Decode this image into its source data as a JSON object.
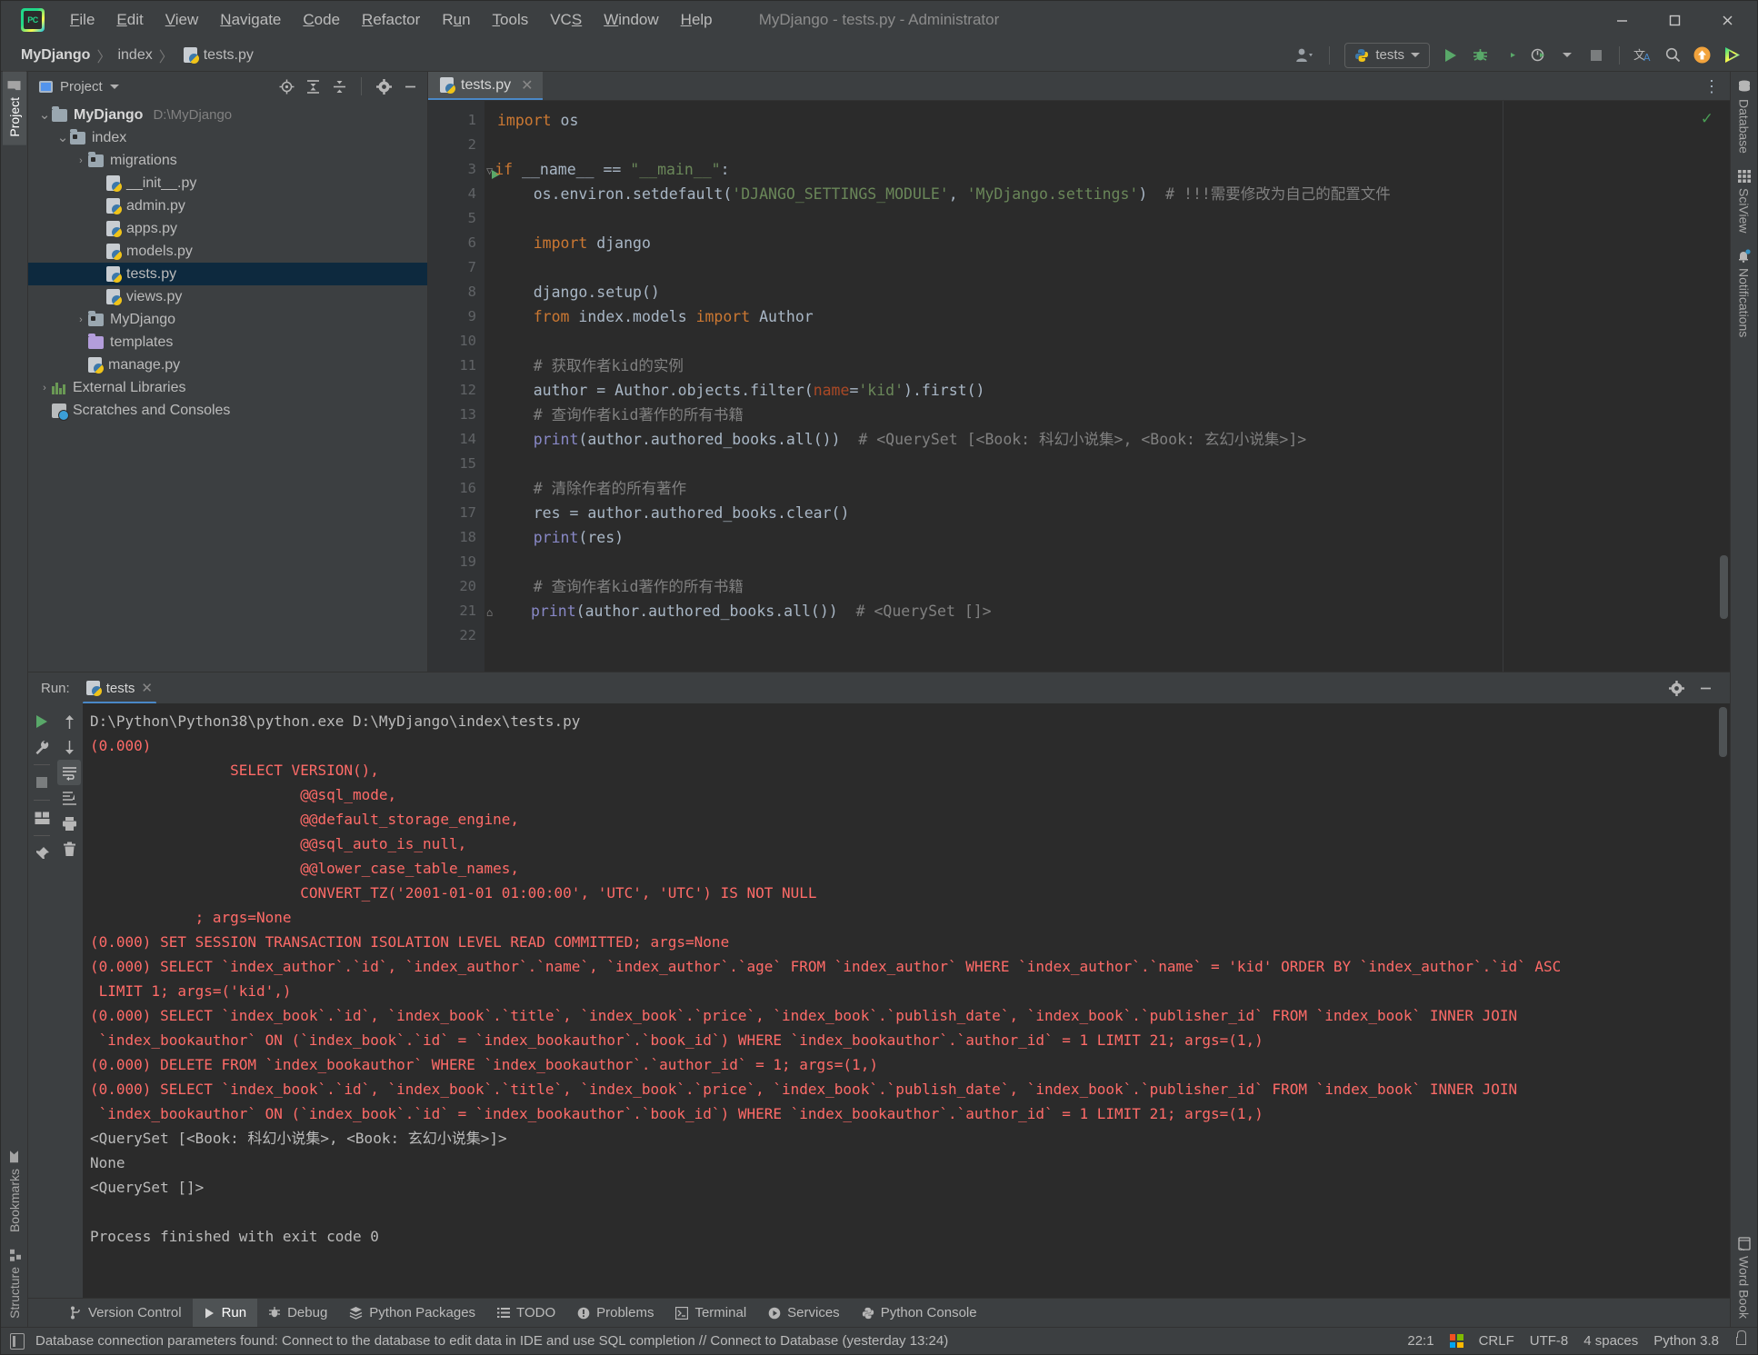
{
  "window": {
    "title": "MyDjango - tests.py - Administrator",
    "minimize": "–",
    "maximize": "☐",
    "close": "✕"
  },
  "menubar": [
    {
      "label": "File",
      "mnemonic": "F"
    },
    {
      "label": "Edit",
      "mnemonic": "E"
    },
    {
      "label": "View",
      "mnemonic": "V"
    },
    {
      "label": "Navigate",
      "mnemonic": "N"
    },
    {
      "label": "Code",
      "mnemonic": "C"
    },
    {
      "label": "Refactor",
      "mnemonic": "R"
    },
    {
      "label": "Run",
      "mnemonic": "u"
    },
    {
      "label": "Tools",
      "mnemonic": "T"
    },
    {
      "label": "VCS",
      "mnemonic": "S"
    },
    {
      "label": "Window",
      "mnemonic": "W"
    },
    {
      "label": "Help",
      "mnemonic": "H"
    }
  ],
  "breadcrumb": {
    "items": [
      "MyDjango",
      "index",
      "tests.py"
    ],
    "separator": "〉"
  },
  "toolbar": {
    "run_config": "tests",
    "icons": [
      "profile-icon",
      "python-icon",
      "run-icon",
      "debug-icon",
      "coverage-icon",
      "profiler-icon",
      "stop-icon",
      "translate-icon",
      "search-everywhere-icon",
      "update-icon",
      "play-gradient-icon"
    ]
  },
  "project_panel": {
    "title": "Project",
    "header_icons": [
      "locate-icon",
      "expand-all-icon",
      "collapse-all-icon",
      "settings-gear-icon",
      "hide-icon"
    ],
    "tree": [
      {
        "label": "MyDjango",
        "path": "D:\\MyDjango",
        "kind": "folder",
        "depth": 0,
        "arrow": "⌄",
        "bold": true
      },
      {
        "label": "index",
        "kind": "folder-src",
        "depth": 1,
        "arrow": "⌄"
      },
      {
        "label": "migrations",
        "kind": "folder-src",
        "depth": 2,
        "arrow": "›"
      },
      {
        "label": "__init__.py",
        "kind": "py",
        "depth": 3
      },
      {
        "label": "admin.py",
        "kind": "py",
        "depth": 3
      },
      {
        "label": "apps.py",
        "kind": "py",
        "depth": 3
      },
      {
        "label": "models.py",
        "kind": "py",
        "depth": 3
      },
      {
        "label": "tests.py",
        "kind": "py",
        "depth": 3,
        "selected": true
      },
      {
        "label": "views.py",
        "kind": "py",
        "depth": 3
      },
      {
        "label": "MyDjango",
        "kind": "folder-src",
        "depth": 2,
        "arrow": "›"
      },
      {
        "label": "templates",
        "kind": "folder-purple",
        "depth": 2
      },
      {
        "label": "manage.py",
        "kind": "py",
        "depth": 2
      },
      {
        "label": "External Libraries",
        "kind": "libs",
        "depth": 0,
        "arrow": "›"
      },
      {
        "label": "Scratches and Consoles",
        "kind": "scratch",
        "depth": 0
      }
    ]
  },
  "editor": {
    "tab": {
      "label": "tests.py",
      "close": "✕"
    },
    "overflow": "⋮",
    "lines": [
      {
        "n": 1,
        "tokens": [
          {
            "t": "import ",
            "c": "k"
          },
          {
            "t": "os",
            "c": "t"
          }
        ]
      },
      {
        "n": 2,
        "tokens": []
      },
      {
        "n": 3,
        "tokens": [
          {
            "t": "if ",
            "c": "k"
          },
          {
            "t": "__name__ ",
            "c": "t"
          },
          {
            "t": "== ",
            "c": "t"
          },
          {
            "t": "\"__main__\"",
            "c": "s"
          },
          {
            "t": ":",
            "c": "t"
          }
        ],
        "runmark": true,
        "fold": "▽"
      },
      {
        "n": 4,
        "tokens": [
          {
            "t": "    os.environ.setdefault(",
            "c": "t"
          },
          {
            "t": "'DJANGO_SETTINGS_MODULE'",
            "c": "s"
          },
          {
            "t": ", ",
            "c": "t"
          },
          {
            "t": "'MyDjango.settings'",
            "c": "s"
          },
          {
            "t": ")  ",
            "c": "t"
          },
          {
            "t": "# !!!需要修改为自己的配置文件",
            "c": "c"
          }
        ]
      },
      {
        "n": 5,
        "tokens": []
      },
      {
        "n": 6,
        "tokens": [
          {
            "t": "    ",
            "c": "t"
          },
          {
            "t": "import ",
            "c": "k"
          },
          {
            "t": "django",
            "c": "t"
          }
        ]
      },
      {
        "n": 7,
        "tokens": []
      },
      {
        "n": 8,
        "tokens": [
          {
            "t": "    django.setup()",
            "c": "t"
          }
        ]
      },
      {
        "n": 9,
        "tokens": [
          {
            "t": "    ",
            "c": "t"
          },
          {
            "t": "from ",
            "c": "k"
          },
          {
            "t": "index.models ",
            "c": "t"
          },
          {
            "t": "import ",
            "c": "k"
          },
          {
            "t": "Author",
            "c": "t"
          }
        ]
      },
      {
        "n": 10,
        "tokens": []
      },
      {
        "n": 11,
        "tokens": [
          {
            "t": "    # 获取作者kid的实例",
            "c": "c"
          }
        ]
      },
      {
        "n": 12,
        "tokens": [
          {
            "t": "    author = Author.objects.filter(",
            "c": "t"
          },
          {
            "t": "name",
            "c": "na"
          },
          {
            "t": "=",
            "c": "t"
          },
          {
            "t": "'kid'",
            "c": "s"
          },
          {
            "t": ").first()",
            "c": "t"
          }
        ]
      },
      {
        "n": 13,
        "tokens": [
          {
            "t": "    # 查询作者kid著作的所有书籍",
            "c": "c"
          }
        ]
      },
      {
        "n": 14,
        "tokens": [
          {
            "t": "    ",
            "c": "t"
          },
          {
            "t": "print",
            "c": "pf"
          },
          {
            "t": "(author.authored_books.all())  ",
            "c": "t"
          },
          {
            "t": "# <QuerySet [<Book: 科幻小说集>, <Book: 玄幻小说集>]>",
            "c": "c"
          }
        ]
      },
      {
        "n": 15,
        "tokens": []
      },
      {
        "n": 16,
        "tokens": [
          {
            "t": "    # 清除作者的所有著作",
            "c": "c"
          }
        ]
      },
      {
        "n": 17,
        "tokens": [
          {
            "t": "    res = author.authored_books.clear()",
            "c": "t"
          }
        ]
      },
      {
        "n": 18,
        "tokens": [
          {
            "t": "    ",
            "c": "t"
          },
          {
            "t": "print",
            "c": "pf"
          },
          {
            "t": "(res)",
            "c": "t"
          }
        ]
      },
      {
        "n": 19,
        "tokens": []
      },
      {
        "n": 20,
        "tokens": [
          {
            "t": "    # 查询作者kid著作的所有书籍",
            "c": "c"
          }
        ]
      },
      {
        "n": 21,
        "tokens": [
          {
            "t": "    ",
            "c": "t"
          },
          {
            "t": "print",
            "c": "pf"
          },
          {
            "t": "(author.authored_books.all())  ",
            "c": "t"
          },
          {
            "t": "# <QuerySet []>",
            "c": "c"
          }
        ],
        "foldend": "⌂"
      },
      {
        "n": 22,
        "tokens": []
      }
    ]
  },
  "run_panel": {
    "label": "Run:",
    "tab": "tests",
    "tab_close": "✕",
    "sidebar_icons": [
      "rerun-icon",
      "wrench-icon",
      "stop-icon",
      "layout-icon",
      "pin-icon"
    ],
    "sidebar2_icons": [
      "up-arrow-icon",
      "down-arrow-icon",
      "soft-wrap-icon",
      "scroll-to-end-icon",
      "print-icon",
      "trash-icon"
    ],
    "header_icons": [
      "settings-gear-icon",
      "hide-icon"
    ],
    "console": [
      {
        "text": "D:\\Python\\Python38\\python.exe D:\\MyDjango\\index\\tests.py",
        "style": "path"
      },
      {
        "text": "(0.000)",
        "style": "err"
      },
      {
        "text": "                SELECT VERSION(),",
        "style": "err"
      },
      {
        "text": "                        @@sql_mode,",
        "style": "err"
      },
      {
        "text": "                        @@default_storage_engine,",
        "style": "err"
      },
      {
        "text": "                        @@sql_auto_is_null,",
        "style": "err"
      },
      {
        "text": "                        @@lower_case_table_names,",
        "style": "err"
      },
      {
        "text": "                        CONVERT_TZ('2001-01-01 01:00:00', 'UTC', 'UTC') IS NOT NULL",
        "style": "err"
      },
      {
        "text": "            ; args=None",
        "style": "err"
      },
      {
        "text": "(0.000) SET SESSION TRANSACTION ISOLATION LEVEL READ COMMITTED; args=None",
        "style": "err"
      },
      {
        "text": "(0.000) SELECT `index_author`.`id`, `index_author`.`name`, `index_author`.`age` FROM `index_author` WHERE `index_author`.`name` = 'kid' ORDER BY `index_author`.`id` ASC",
        "style": "err"
      },
      {
        "text": " LIMIT 1; args=('kid',)",
        "style": "err"
      },
      {
        "text": "(0.000) SELECT `index_book`.`id`, `index_book`.`title`, `index_book`.`price`, `index_book`.`publish_date`, `index_book`.`publisher_id` FROM `index_book` INNER JOIN",
        "style": "err"
      },
      {
        "text": " `index_bookauthor` ON (`index_book`.`id` = `index_bookauthor`.`book_id`) WHERE `index_bookauthor`.`author_id` = 1 LIMIT 21; args=(1,)",
        "style": "err"
      },
      {
        "text": "(0.000) DELETE FROM `index_bookauthor` WHERE `index_bookauthor`.`author_id` = 1; args=(1,)",
        "style": "err"
      },
      {
        "text": "(0.000) SELECT `index_book`.`id`, `index_book`.`title`, `index_book`.`price`, `index_book`.`publish_date`, `index_book`.`publisher_id` FROM `index_book` INNER JOIN",
        "style": "err"
      },
      {
        "text": " `index_bookauthor` ON (`index_book`.`id` = `index_bookauthor`.`book_id`) WHERE `index_bookauthor`.`author_id` = 1 LIMIT 21; args=(1,)",
        "style": "err"
      },
      {
        "text": "<QuerySet [<Book: 科幻小说集>, <Book: 玄幻小说集>]>",
        "style": "path"
      },
      {
        "text": "None",
        "style": "path"
      },
      {
        "text": "<QuerySet []>",
        "style": "path"
      },
      {
        "text": "",
        "style": "path"
      },
      {
        "text": "Process finished with exit code 0",
        "style": "path"
      }
    ]
  },
  "left_strip": {
    "top": [
      {
        "label": "Project",
        "icon": "project-folder-icon",
        "active": true
      }
    ],
    "bottom": [
      {
        "label": "Bookmarks",
        "icon": "bookmark-icon"
      },
      {
        "label": "Structure",
        "icon": "structure-icon"
      }
    ]
  },
  "right_strip": {
    "top": [
      {
        "label": "Database",
        "icon": "database-icon"
      },
      {
        "label": "SciView",
        "icon": "grid-icon"
      },
      {
        "label": "Notifications",
        "icon": "bell-icon"
      }
    ],
    "bottom": [
      {
        "label": "Word Book",
        "icon": "book-icon"
      }
    ]
  },
  "tool_windows": [
    {
      "label": "Version Control",
      "icon": "branch-icon",
      "active": false
    },
    {
      "label": "Run",
      "icon": "run-triangle-icon",
      "active": true
    },
    {
      "label": "Debug",
      "icon": "bug-icon",
      "active": false
    },
    {
      "label": "Python Packages",
      "icon": "packages-icon",
      "active": false
    },
    {
      "label": "TODO",
      "icon": "list-icon",
      "active": false
    },
    {
      "label": "Problems",
      "icon": "warning-icon",
      "active": false
    },
    {
      "label": "Terminal",
      "icon": "terminal-icon",
      "active": false
    },
    {
      "label": "Services",
      "icon": "services-icon",
      "active": false
    },
    {
      "label": "Python Console",
      "icon": "python-icon",
      "active": false
    }
  ],
  "statusbar": {
    "message": "Database connection parameters found: Connect to the database to edit data in IDE and use SQL completion // Connect to Database (yesterday 13:24)",
    "caret": "22:1",
    "line_sep": "CRLF",
    "encoding": "UTF-8",
    "indent": "4 spaces",
    "interpreter": "Python 3.8"
  },
  "colors": {
    "accent": "#4a88c7",
    "run_green": "#59a869",
    "error_red": "#ff6b68",
    "selection": "#0d293e",
    "editor_bg": "#2b2b2b",
    "panel_bg": "#3c3f41"
  }
}
